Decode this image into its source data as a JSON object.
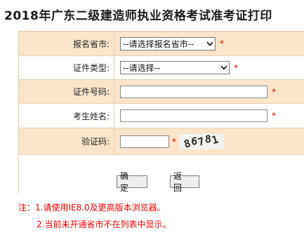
{
  "page": {
    "title": "2018年广东二级建造师执业资格考试准考证打印"
  },
  "form": {
    "province": {
      "label": "报名省市:",
      "selected": "--请选择报名省市--",
      "required_mark": "*"
    },
    "id_type": {
      "label": "证件类型:",
      "selected": "--请选择--",
      "required_mark": "*"
    },
    "id_number": {
      "label": "证件号码:",
      "value": "",
      "required_mark": "*"
    },
    "name": {
      "label": "考生姓名:",
      "value": "",
      "required_mark": "*"
    },
    "captcha": {
      "label": "验证码:",
      "value": "",
      "required_mark": "*",
      "image_text": "86781"
    }
  },
  "buttons": {
    "confirm": "确 定",
    "back": "返 回"
  },
  "notes": {
    "line1": "注：1.请使用IE8.0及更高版本浏览器。",
    "line2": "2.当前未开通省市不在列表中显示。"
  },
  "colors": {
    "row_tan": "#fbe4c9",
    "required_red": "#e60000",
    "border": "#e2c9a8"
  }
}
